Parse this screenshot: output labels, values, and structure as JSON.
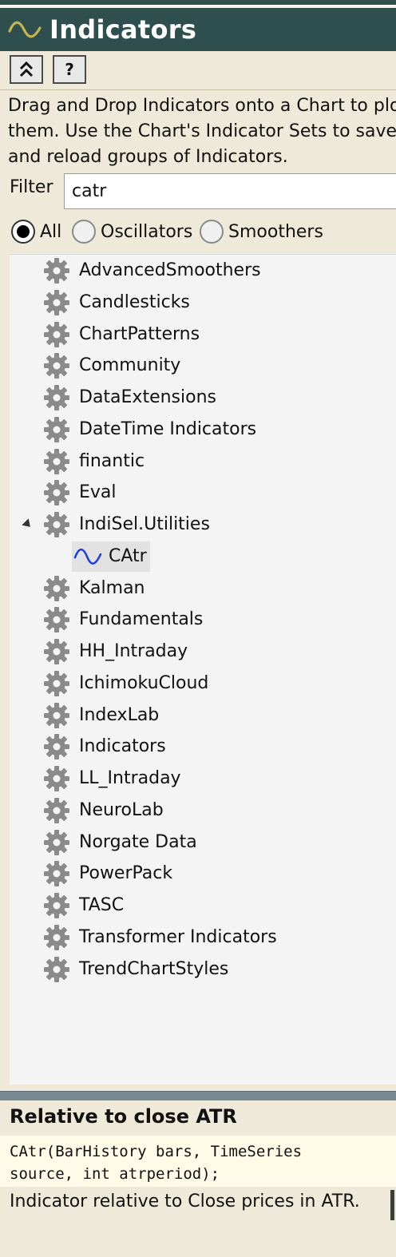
{
  "panel": {
    "title": "Indicators",
    "title_icon": "sine-wave-icon"
  },
  "toolbar": {
    "collapse_label": "˄˄",
    "collapse_icon": "double-chevron-up-icon",
    "help_label": "?"
  },
  "description": {
    "line1": "Drag and Drop Indicators onto a Chart to plot",
    "line2": "them. Use the Chart's Indicator Sets to save",
    "line3": "and reload groups of Indicators."
  },
  "filter": {
    "label": "Filter",
    "value": "catr"
  },
  "radios": [
    {
      "label": "All",
      "checked": true
    },
    {
      "label": "Oscillators",
      "checked": false
    },
    {
      "label": "Smoothers",
      "checked": false
    }
  ],
  "tree": {
    "items": [
      "AdvancedSmoothers",
      "Candlesticks",
      "ChartPatterns",
      "Community",
      "DataExtensions",
      "DateTime Indicators",
      "finantic",
      "Eval",
      "IndiSel.Utilities",
      "Kalman",
      "Fundamentals",
      "HH_Intraday",
      "IchimokuCloud",
      "IndexLab",
      "Indicators",
      "LL_Intraday",
      "NeuroLab",
      "Norgate Data",
      "PowerPack",
      "TASC",
      "Transformer Indicators",
      "TrendChartStyles"
    ],
    "expanded_child": {
      "label": "CAtr",
      "icon": "sine-wave-icon"
    }
  },
  "help": {
    "title": "Relative to close ATR",
    "signature_line1": "CAtr(BarHistory bars, TimeSeries",
    "signature_line2": "source, int atrperiod);",
    "description": "Indicator relative to Close prices in ATR."
  },
  "colors": {
    "header_bg": "#2f4f4f",
    "panel_bg": "#efe9d9",
    "tree_bg": "#f4f4f4",
    "accent_wave": "#1f3fdc"
  }
}
